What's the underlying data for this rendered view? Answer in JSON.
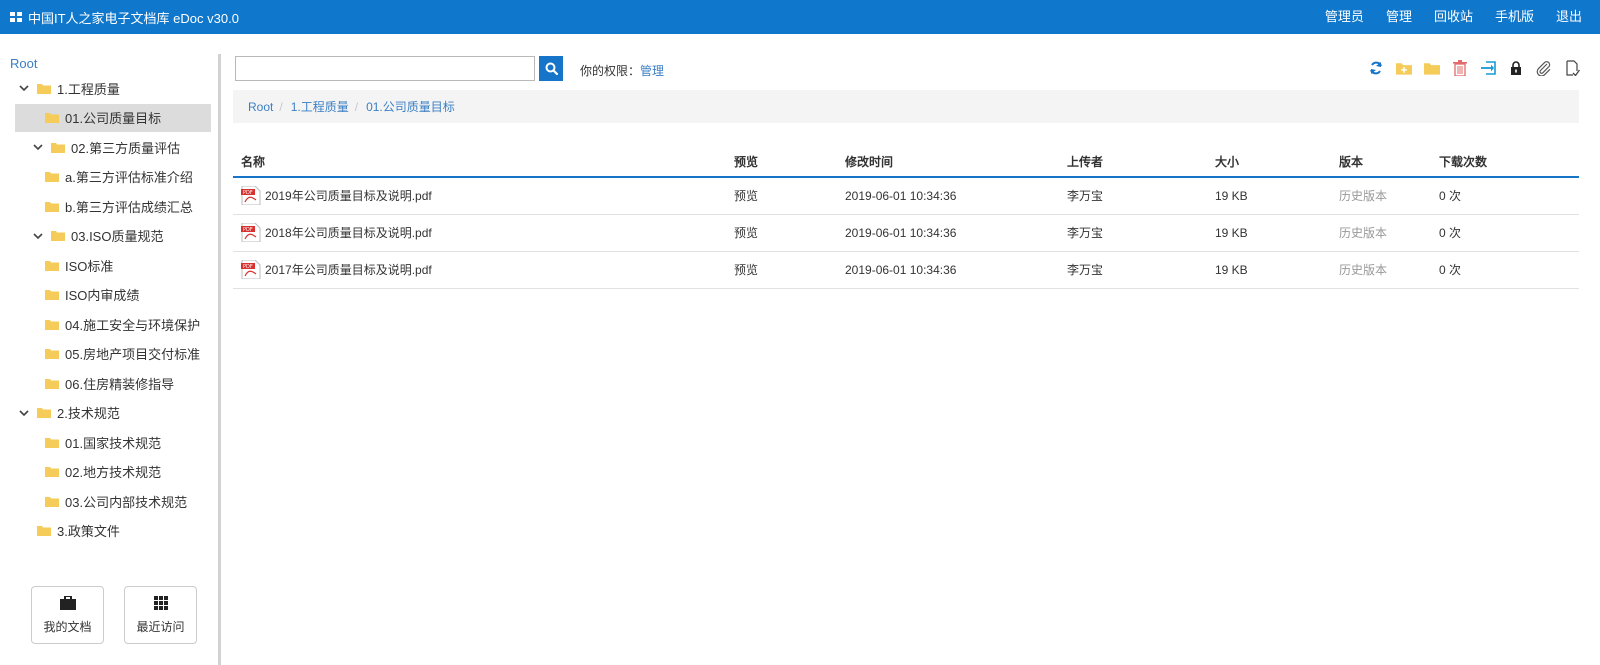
{
  "app": {
    "title": "中国IT人之家电子文档库 eDoc v30.0"
  },
  "topnav": [
    "管理员",
    "管理",
    "回收站",
    "手机版",
    "退出"
  ],
  "tree": {
    "root": "Root",
    "items": [
      {
        "label": "1.工程质量",
        "level": 0,
        "expanded": true
      },
      {
        "label": "01.公司质量目标",
        "level": 1,
        "selected": true
      },
      {
        "label": "02.第三方质量评估",
        "level": 1,
        "expanded": true
      },
      {
        "label": "a.第三方评估标准介绍",
        "level": 2
      },
      {
        "label": "b.第三方评估成绩汇总",
        "level": 2
      },
      {
        "label": "03.ISO质量规范",
        "level": 1,
        "expanded": true
      },
      {
        "label": "ISO标准",
        "level": 2
      },
      {
        "label": "ISO内审成绩",
        "level": 2
      },
      {
        "label": "04.施工安全与环境保护",
        "level": 2
      },
      {
        "label": "05.房地产项目交付标准",
        "level": 2
      },
      {
        "label": "06.住房精装修指导",
        "level": 2
      },
      {
        "label": "2.技术规范",
        "level": 0,
        "expanded": true
      },
      {
        "label": "01.国家技术规范",
        "level": 2
      },
      {
        "label": "02.地方技术规范",
        "level": 2
      },
      {
        "label": "03.公司内部技术规范",
        "level": 2
      },
      {
        "label": "3.政策文件",
        "level": 0
      }
    ]
  },
  "sidebar_buttons": {
    "my_docs": "我的文档",
    "recent": "最近访问"
  },
  "search": {
    "value": "",
    "placeholder": ""
  },
  "permission": {
    "label": "你的权限：",
    "value": "管理"
  },
  "breadcrumb": [
    "Root",
    "1.工程质量",
    "01.公司质量目标"
  ],
  "table": {
    "headers": [
      "名称",
      "预览",
      "修改时间",
      "上传者",
      "大小",
      "版本",
      "下载次数"
    ],
    "rows": [
      {
        "name": "2019年公司质量目标及说明.pdf",
        "preview": "预览",
        "modified": "2019-06-01 10:34:36",
        "uploader": "李万宝",
        "size": "19 KB",
        "version": "历史版本",
        "downloads": "0 次"
      },
      {
        "name": "2018年公司质量目标及说明.pdf",
        "preview": "预览",
        "modified": "2019-06-01 10:34:36",
        "uploader": "李万宝",
        "size": "19 KB",
        "version": "历史版本",
        "downloads": "0 次"
      },
      {
        "name": "2017年公司质量目标及说明.pdf",
        "preview": "预览",
        "modified": "2019-06-01 10:34:36",
        "uploader": "李万宝",
        "size": "19 KB",
        "version": "历史版本",
        "downloads": "0 次"
      }
    ]
  },
  "toolbar_icons": [
    "refresh-icon",
    "new-folder-icon",
    "folder-icon",
    "delete-icon",
    "move-icon",
    "lock-icon",
    "attach-icon",
    "upload-icon"
  ],
  "colors": {
    "topbar": "#0f77cc",
    "link": "#3b7fc4",
    "folder": "#f5cc5a",
    "accent": "#1674c9"
  }
}
